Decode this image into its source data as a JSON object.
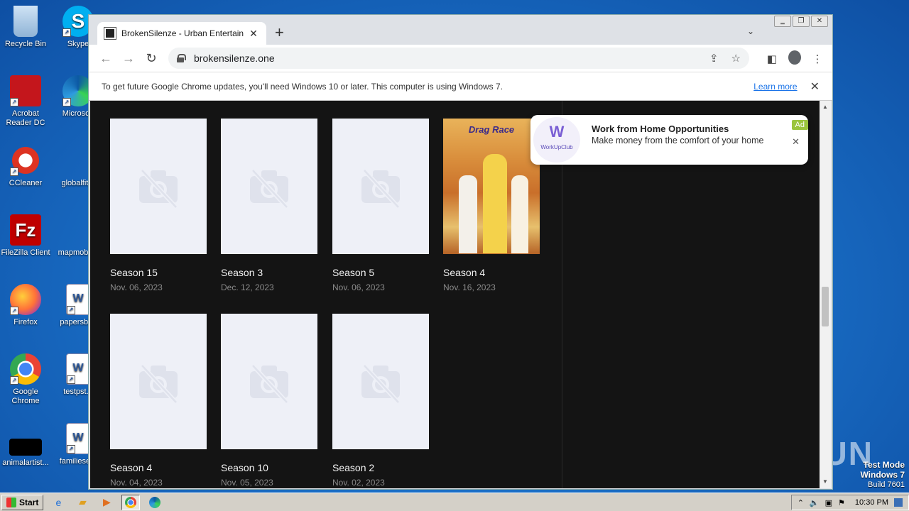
{
  "desktop": {
    "icons": [
      {
        "label": "Recycle Bin",
        "icon": "recycle-bin-icon"
      },
      {
        "label": "Skype",
        "icon": "skype-icon"
      },
      {
        "label": "Acrobat Reader DC",
        "icon": "acrobat-icon"
      },
      {
        "label": "Microsoft",
        "icon": "edge-icon"
      },
      {
        "label": "CCleaner",
        "icon": "ccleaner-icon"
      },
      {
        "label": "globalfit...",
        "icon": "blank-file-icon"
      },
      {
        "label": "FileZilla Client",
        "icon": "filezilla-icon"
      },
      {
        "label": "mapmobil...",
        "icon": "blank-file-icon"
      },
      {
        "label": "Firefox",
        "icon": "firefox-icon"
      },
      {
        "label": "papersbi...",
        "icon": "word-doc-icon"
      },
      {
        "label": "Google Chrome",
        "icon": "chrome-icon"
      },
      {
        "label": "testpst...",
        "icon": "word-doc-icon"
      },
      {
        "label": "animalartist...",
        "icon": "black-file-icon"
      },
      {
        "label": "familiese...",
        "icon": "word-doc-icon"
      }
    ],
    "watermark": "ANY RUN",
    "testmode": {
      "line1": "Test Mode",
      "line2": "Windows 7",
      "line3": "Build 7601"
    }
  },
  "browser": {
    "tab_title": "BrokenSilenze - Urban Entertainment",
    "url": "brokensilenze.one",
    "infobar": {
      "message": "To get future Google Chrome updates, you'll need Windows 10 or later. This computer is using Windows 7.",
      "link": "Learn more"
    }
  },
  "cards": [
    {
      "name": "Season 15",
      "date": "Nov. 06, 2023",
      "image": false
    },
    {
      "name": "Season 3",
      "date": "Dec. 12, 2023",
      "image": false
    },
    {
      "name": "Season 5",
      "date": "Nov. 06, 2023",
      "image": false
    },
    {
      "name": "Season 4",
      "date": "Nov. 16, 2023",
      "image": true,
      "poster_text": "Drag Race"
    },
    {
      "name": "Season 4",
      "date": "Nov. 04, 2023",
      "image": false
    },
    {
      "name": "Season 10",
      "date": "Nov. 05, 2023",
      "image": false
    },
    {
      "name": "Season 2",
      "date": "Nov. 02, 2023",
      "image": false
    }
  ],
  "ad": {
    "title": "Work from Home Opportunities",
    "text": "Make money from the comfort of your home",
    "badge": "Ad",
    "logo_text": "WorkUpClub"
  },
  "taskbar": {
    "start": "Start",
    "time": "10:30 PM"
  }
}
